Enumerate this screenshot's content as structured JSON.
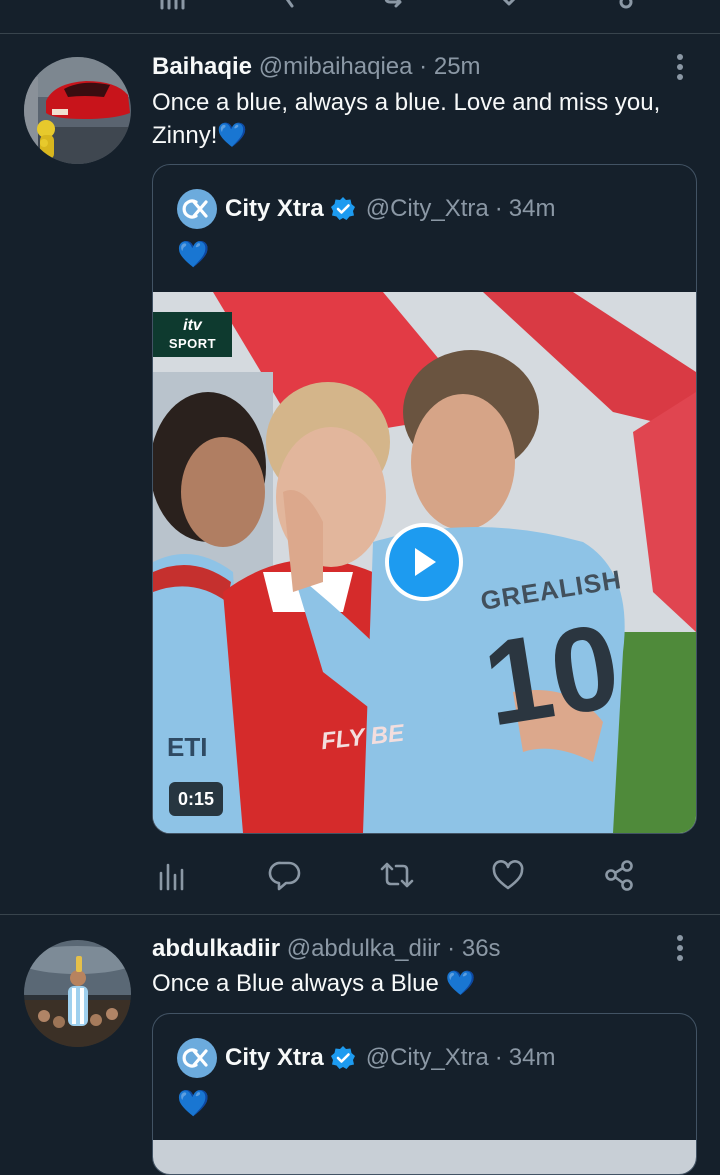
{
  "colors": {
    "background": "#15202b",
    "divider": "#38444d",
    "text_primary": "#f7f9f9",
    "text_secondary": "#8b98a5",
    "accent": "#1d9bf0",
    "city_blue": "#6cabdd"
  },
  "top_action_icons": [
    "analytics-icon",
    "reply-icon",
    "retweet-icon",
    "like-icon",
    "share-icon"
  ],
  "tweets": [
    {
      "author_name": "Baihaqie",
      "handle": "@mibaihaqiea",
      "separator": "·",
      "time": "25m",
      "text_line1": "Once a blue, always a blue. Love and miss you,",
      "text_line2": "Zinny!",
      "emoji": "💙",
      "quote": {
        "author_name": "City Xtra",
        "handle": "@City_Xtra",
        "separator": "·",
        "time": "34m",
        "text": "💙",
        "video": {
          "badge_top": "itv",
          "badge_bottom": "SPORT",
          "duration": "0:15",
          "shirt_name": "GREALISH",
          "shirt_number": "10",
          "sponsor_text": "FLY BE",
          "etihad_text": "ETI"
        }
      },
      "action_icons": [
        "analytics-icon",
        "reply-icon",
        "retweet-icon",
        "like-icon",
        "share-icon"
      ]
    },
    {
      "author_name": "abdulkadiir",
      "handle": "@abdulka_diir",
      "separator": "·",
      "time": "36s",
      "text_line1": "Once a Blue always a Blue",
      "emoji": "💙",
      "quote": {
        "author_name": "City Xtra",
        "handle": "@City_Xtra",
        "separator": "·",
        "time": "34m",
        "text": "💙"
      }
    }
  ]
}
